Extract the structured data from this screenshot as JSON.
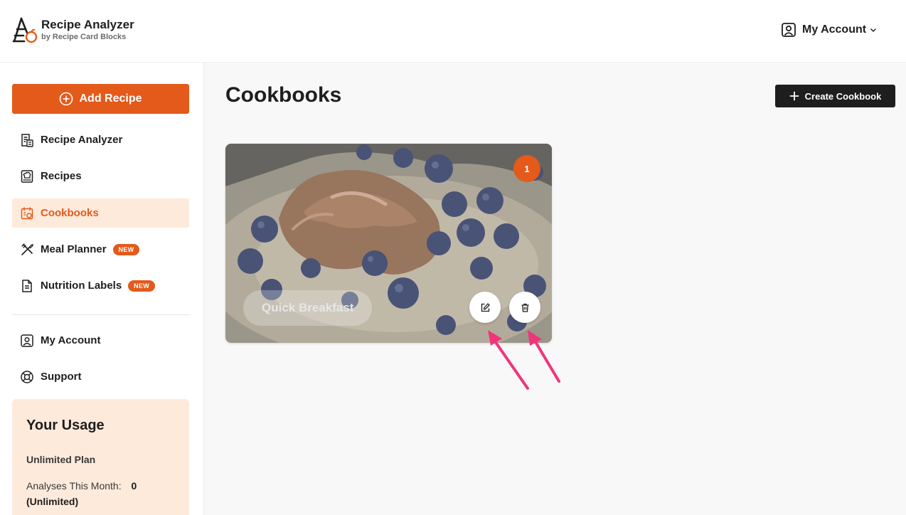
{
  "brand": {
    "title": "Recipe Analyzer",
    "subtitle": "by Recipe Card Blocks",
    "logo_icon": "recipe-analyzer-logo-icon"
  },
  "header": {
    "account_label": "My Account",
    "account_icon": "user-badge-icon",
    "chevron_icon": "chevron-down-icon"
  },
  "sidebar": {
    "add_button": {
      "label": "Add Recipe",
      "icon": "plus-circle-icon"
    },
    "items": [
      {
        "label": "Recipe Analyzer",
        "icon": "calculator-doc-icon",
        "active": false,
        "badge": ""
      },
      {
        "label": "Recipes",
        "icon": "chef-book-icon",
        "active": false,
        "badge": ""
      },
      {
        "label": "Cookbooks",
        "icon": "calendar-book-icon",
        "active": true,
        "badge": ""
      },
      {
        "label": "Meal Planner",
        "icon": "utensils-icon",
        "active": false,
        "badge": "NEW"
      },
      {
        "label": "Nutrition Labels",
        "icon": "document-icon",
        "active": false,
        "badge": "NEW"
      }
    ],
    "secondary_items": [
      {
        "label": "My Account",
        "icon": "user-badge-icon"
      },
      {
        "label": "Support",
        "icon": "lifebuoy-icon"
      }
    ],
    "usage": {
      "title": "Your Usage",
      "plan": "Unlimited Plan",
      "analyses_label": "Analyses This Month:",
      "analyses_value": "0",
      "analyses_note": "(Unlimited)"
    }
  },
  "main": {
    "title": "Cookbooks",
    "create_button": {
      "label": "Create Cookbook",
      "icon": "plus-icon"
    },
    "cookbooks": [
      {
        "title": "Quick Breakfast",
        "count": "1",
        "edit_icon": "edit-icon",
        "delete_icon": "trash-icon"
      }
    ]
  },
  "colors": {
    "accent": "#e35a1a",
    "accent_soft": "#fdeadb",
    "dark": "#1e1e1e",
    "annotation_arrow": "#f0357a"
  }
}
